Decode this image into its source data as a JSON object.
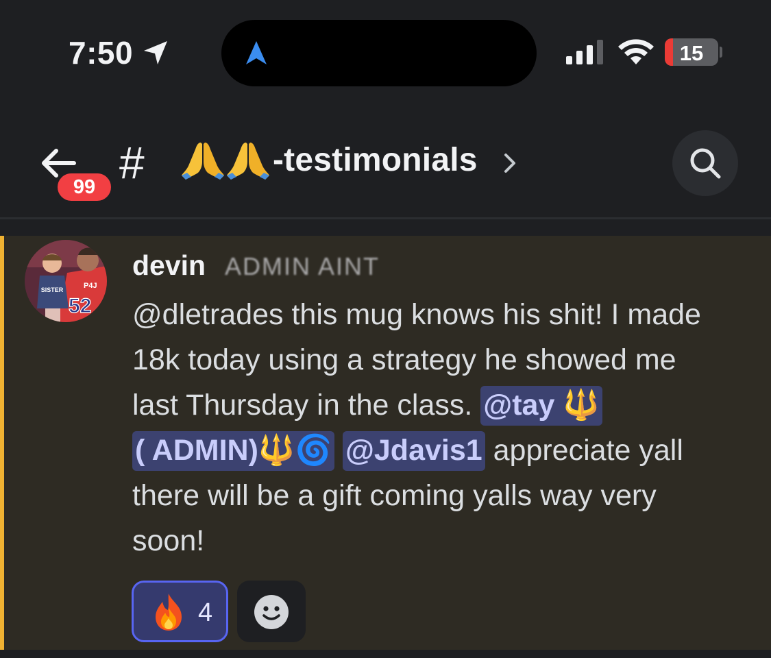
{
  "status_bar": {
    "time": "7:50",
    "battery": "15",
    "battery_level": 0.15,
    "icons": [
      "location-arrow-icon",
      "navigation-arrow-icon",
      "cell-signal-icon",
      "wifi-icon",
      "battery-icon"
    ]
  },
  "header": {
    "unread_count": "99",
    "hash": "#",
    "channel_emoji": [
      "🙏",
      "🙏"
    ],
    "channel_name": "-testimonials",
    "icons": [
      "back-arrow-icon",
      "chevron-right-icon",
      "search-icon"
    ]
  },
  "message": {
    "author": "devin",
    "author_tag": "ADMIN AINT",
    "lines": [
      [
        {
          "t": "text",
          "v": "@dletrades this mug knows his shit! I made"
        }
      ],
      [
        {
          "t": "text",
          "v": "18k today using a strategy he showed me"
        }
      ],
      [
        {
          "t": "text",
          "v": "last Thursday in the class. "
        },
        {
          "t": "mention",
          "v": "@tay 🔱"
        }
      ],
      [
        {
          "t": "mention",
          "v": "( ADMIN)🔱🌀"
        },
        {
          "t": "text",
          "v": " "
        },
        {
          "t": "mention",
          "v": "@Jdavis1"
        },
        {
          "t": "text",
          "v": "  appreciate yall"
        }
      ],
      [
        {
          "t": "text",
          "v": "there will be a gift coming yalls way very"
        }
      ],
      [
        {
          "t": "text",
          "v": "soon!"
        }
      ]
    ],
    "reactions": [
      {
        "emoji": "🔥",
        "count": "4",
        "selected": true
      }
    ],
    "add_reaction_icon": "smiley-icon"
  },
  "colors": {
    "background": "#1e1f22",
    "message_highlight": "#2e2b23",
    "highlight_bar": "#f0b232",
    "mention_bg": "#3c4270",
    "mention_text": "#c9cdfb",
    "badge_red": "#f23f43",
    "reaction_border": "#5865f2"
  }
}
